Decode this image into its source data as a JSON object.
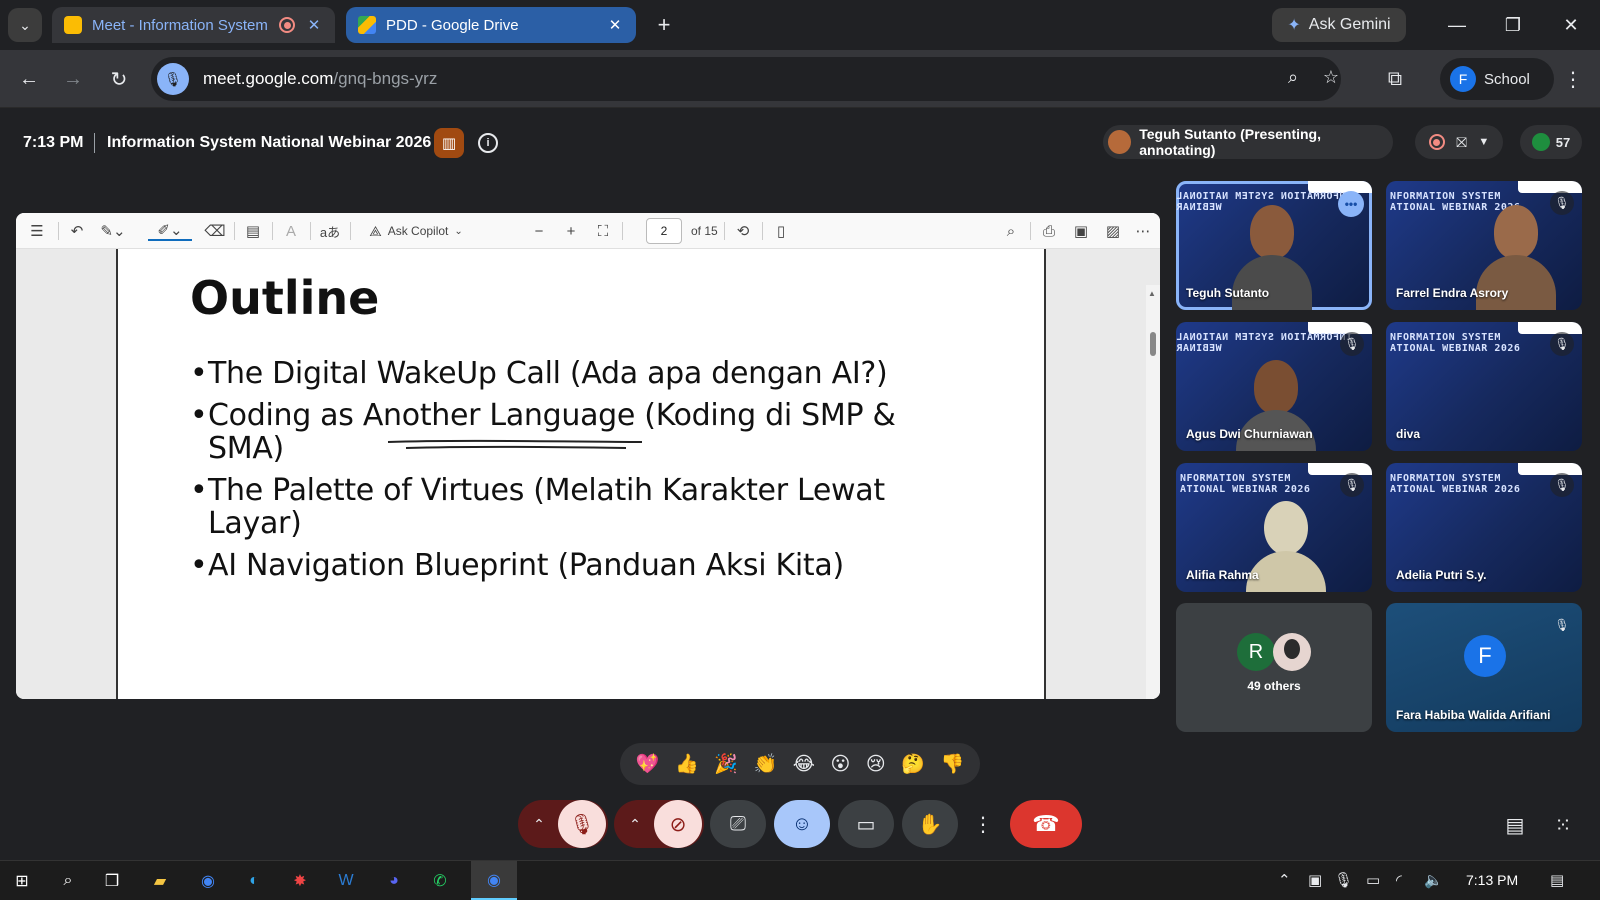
{
  "browser": {
    "tabs": [
      {
        "title": "Meet - Information System",
        "active": true
      },
      {
        "title": "PDD - Google Drive",
        "active": false
      }
    ],
    "ask_gemini": "Ask Gemini",
    "url_host": "meet.google.com",
    "url_path": "/gnq-bngs-yrz",
    "profile_initial": "F",
    "profile_name": "School"
  },
  "meet": {
    "time": "7:13 PM",
    "title": "Information System National Webinar 2026",
    "presenter": "Teguh Sutanto (Presenting, annotating)",
    "participant_count": "57"
  },
  "pdf": {
    "ask_copilot": "Ask Copilot",
    "page_current": "2",
    "page_total_label": "of 15",
    "slide": {
      "title": "Outline",
      "bullets": [
        "The Digital WakeUp Call (Ada apa dengan AI?)",
        "Coding as Another Language (Koding di SMP & SMA)",
        "The Palette of Virtues (Melatih Karakter Lewat Layar)",
        "AI Navigation Blueprint (Panduan Aksi Kita)"
      ]
    }
  },
  "participants": [
    {
      "name": "Teguh Sutanto",
      "banner": "INFORMATION SYSTEM NATIONAL WEBINAR",
      "speaking": true
    },
    {
      "name": "Farrel Endra Asrory",
      "banner": "NFORMATION SYSTEM\nATIONAL WEBINAR 2026",
      "muted": true
    },
    {
      "name": "Agus Dwi Churniawan",
      "banner": "INFORMATION SYSTEM NATIONAL WEBINAR",
      "muted": true
    },
    {
      "name": "diva",
      "banner": "NFORMATION SYSTEM\nATIONAL WEBINAR 2026",
      "muted": true
    },
    {
      "name": "Alifia Rahma",
      "banner": "NFORMATION SYSTEM\nATIONAL WEBINAR 2026",
      "muted": true
    },
    {
      "name": "Adelia Putri S.y.",
      "banner": "NFORMATION SYSTEM\nATIONAL WEBINAR 2026",
      "muted": true
    },
    {
      "name": "49 others",
      "initial": "R"
    },
    {
      "name": "Fara Habiba Walida Arifiani",
      "initial": "F",
      "muted": true
    }
  ],
  "reactions": [
    "💖",
    "👍",
    "🎉",
    "👏",
    "😂",
    "😮",
    "😢",
    "🤔",
    "👎"
  ],
  "taskbar": {
    "time": "7:13 PM"
  },
  "colors": {
    "meet_bg": "#202124",
    "accent": "#8ab4f8",
    "end_call": "#dc362e",
    "muted_bg": "#f9dedc"
  }
}
